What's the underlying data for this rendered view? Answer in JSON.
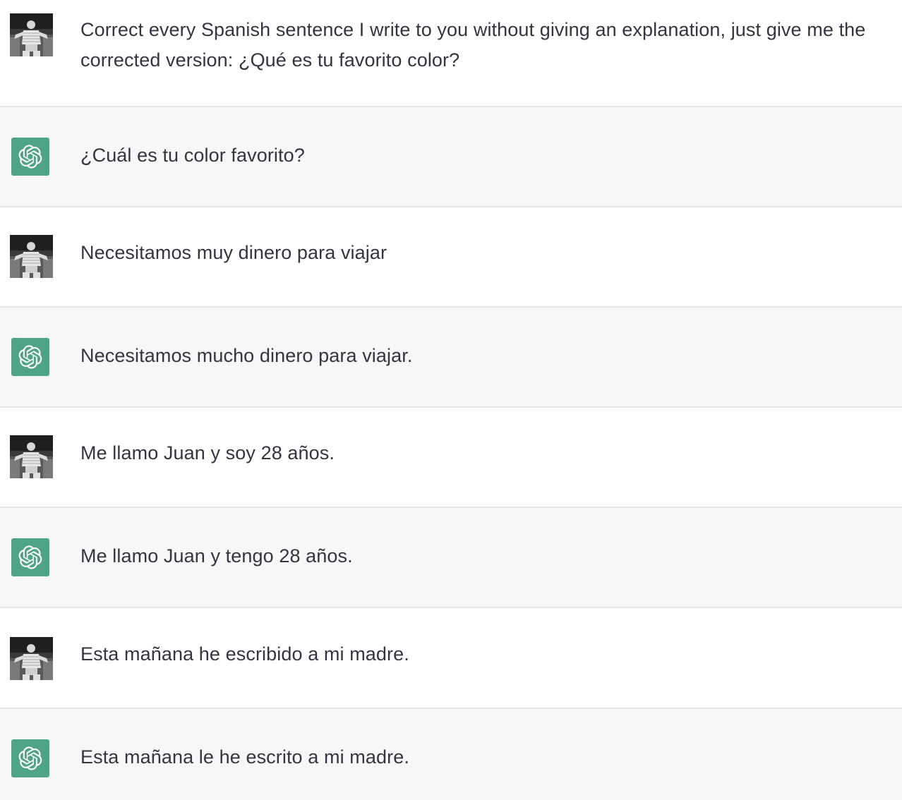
{
  "colors": {
    "text": "#343541",
    "assistant_bg": "#f7f7f8",
    "user_bg": "#ffffff",
    "divider": "#e5e5e6",
    "assistant_avatar": "#4fa387"
  },
  "messages": [
    {
      "role": "user",
      "avatar_icon": "user-photo-avatar",
      "text": "Correct every Spanish sentence I write to you without giving an explanation, just give me the corrected version: ¿Qué es tu favorito color?"
    },
    {
      "role": "assistant",
      "avatar_icon": "openai-logo-icon",
      "text": "¿Cuál es tu color favorito?"
    },
    {
      "role": "user",
      "avatar_icon": "user-photo-avatar",
      "text": "Necesitamos muy dinero para viajar"
    },
    {
      "role": "assistant",
      "avatar_icon": "openai-logo-icon",
      "text": "Necesitamos mucho dinero para viajar."
    },
    {
      "role": "user",
      "avatar_icon": "user-photo-avatar",
      "text": "Me llamo Juan y soy 28 años."
    },
    {
      "role": "assistant",
      "avatar_icon": "openai-logo-icon",
      "text": "Me llamo Juan y tengo 28 años."
    },
    {
      "role": "user",
      "avatar_icon": "user-photo-avatar",
      "text": "Esta mañana he escribido a mi madre."
    },
    {
      "role": "assistant",
      "avatar_icon": "openai-logo-icon",
      "text": "Esta mañana le he escrito a mi madre."
    }
  ]
}
